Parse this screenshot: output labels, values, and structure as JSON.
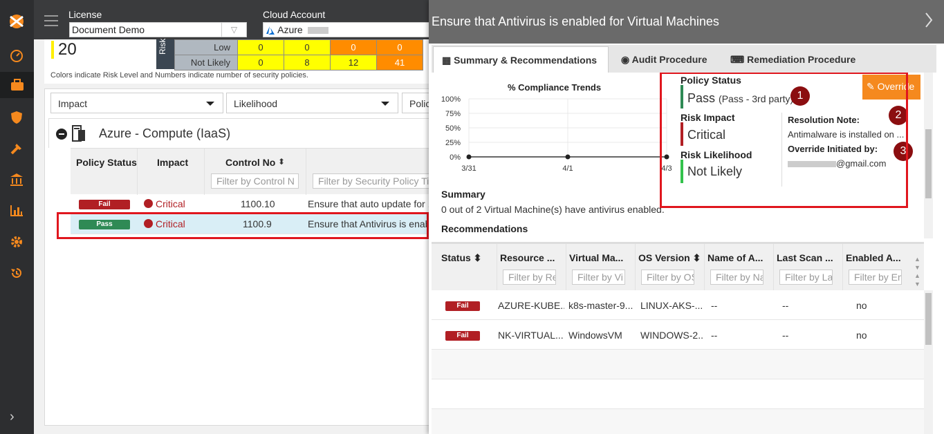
{
  "header": {
    "license_label": "License",
    "license_value": "Document Demo",
    "cloud_label": "Cloud Account",
    "cloud_value": "Azure"
  },
  "risk_card": {
    "score": "20",
    "risk_label": "Risk",
    "rows": [
      {
        "label": "Low",
        "cells": [
          "0",
          "0",
          "0",
          "0"
        ]
      },
      {
        "label": "Not Likely",
        "cells": [
          "0",
          "8",
          "12",
          "41"
        ]
      }
    ],
    "note": "Colors indicate Risk Level and Numbers indicate number of security policies."
  },
  "filters": {
    "impact": "Impact",
    "likelihood": "Likelihood",
    "policy": "Polic"
  },
  "group": {
    "title": "Azure - Compute (IaaS)"
  },
  "grid": {
    "headers": {
      "status": "Policy Status",
      "impact": "Impact",
      "control": "Control No",
      "title_filter": "Filter by Security Policy Tit",
      "control_filter": "Filter by Control N"
    },
    "rows": [
      {
        "status": "Fail",
        "impact": "Critical",
        "control": "1100.10",
        "title": "Ensure that auto update for ."
      },
      {
        "status": "Pass",
        "impact": "Critical",
        "control": "1100.9",
        "title": "Ensure that Antivirus is enab"
      }
    ]
  },
  "drawer": {
    "title": "Ensure that Antivirus is enabled for Virtual Machines",
    "tabs": [
      "Summary & Recommendations",
      "Audit Procedure",
      "Remediation Procedure"
    ],
    "chart_title": "% Compliance Trends",
    "policy_status_label": "Policy Status",
    "policy_status_value": "Pass",
    "policy_status_sub": "(Pass - 3rd party)",
    "override_label": "Override",
    "risk_impact_label": "Risk Impact",
    "risk_impact_value": "Critical",
    "risk_likelihood_label": "Risk Likelihood",
    "risk_likelihood_value": "Not Likely",
    "resolution_note_label": "Resolution Note:",
    "resolution_note_value": "Antimalware is installed on ...",
    "override_by_label": "Override Initiated by:",
    "override_by_value": "@gmail.com",
    "summary_label": "Summary",
    "summary_text": "0 out of 2 Virtual Machine(s) have antivirus enabled.",
    "recommendations_label": "Recommendations",
    "markers": [
      "1",
      "2",
      "3"
    ]
  },
  "chart_data": {
    "type": "line",
    "title": "% Compliance Trends",
    "categories": [
      "3/31",
      "4/1",
      "4/3"
    ],
    "series": [
      {
        "values": [
          0,
          0,
          0
        ]
      }
    ],
    "y_ticks": [
      "100%",
      "75%",
      "50%",
      "25%",
      "0%"
    ],
    "ylim": [
      0,
      100
    ],
    "grid": true
  },
  "resources": {
    "headers": [
      {
        "title": "Status",
        "filter": ""
      },
      {
        "title": "Resource ...",
        "filter": "Filter by Re"
      },
      {
        "title": "Virtual Ma...",
        "filter": "Filter by Vi"
      },
      {
        "title": "OS Version",
        "filter": "Filter by OS"
      },
      {
        "title": "Name of A...",
        "filter": "Filter by Na"
      },
      {
        "title": "Last Scan ...",
        "filter": "Filter by La"
      },
      {
        "title": "Enabled A...",
        "filter": "Filter by En"
      }
    ],
    "rows": [
      {
        "status": "Fail",
        "resource": "AZURE-KUBE...",
        "vm": "k8s-master-9...",
        "os": "LINUX-AKS-...",
        "name": "--",
        "last_scan": "--",
        "enabled": "no"
      },
      {
        "status": "Fail",
        "resource": "NK-VIRTUAL...",
        "vm": "WindowsVM",
        "os": "WINDOWS-2...",
        "name": "--",
        "last_scan": "--",
        "enabled": "no"
      }
    ]
  },
  "colors": {
    "accent_orange": "#f5891e",
    "fail": "#b11f24",
    "pass": "#2f8a55",
    "highlight_red": "#e0161e"
  }
}
